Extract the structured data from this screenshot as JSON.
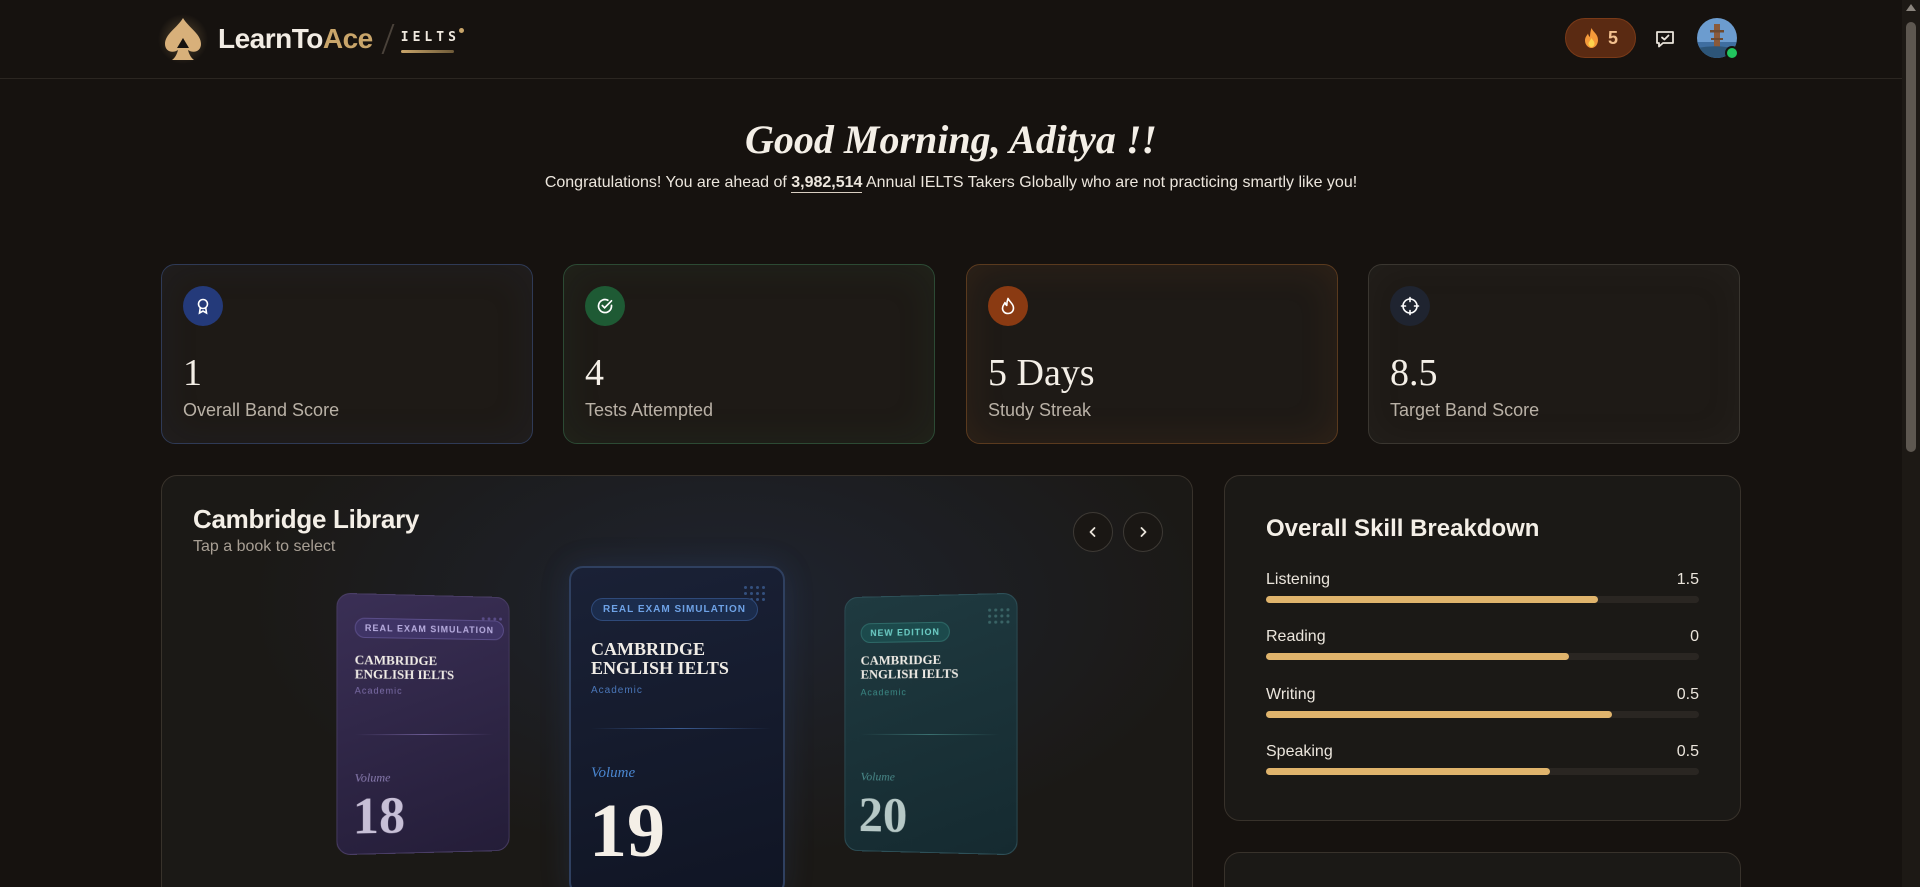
{
  "header": {
    "brand_learn": "LearnTo",
    "brand_ace": "Ace",
    "exam_tag": "IELTS",
    "streak_count": "5",
    "icons": [
      "spade-logo-icon",
      "fire-icon",
      "message-icon",
      "avatar"
    ]
  },
  "greeting": {
    "title": "Good Morning, Aditya !!",
    "congrats_before": "Congratulations! You are ahead of ",
    "congrats_number": "3,982,514",
    "congrats_after": " Annual IELTS Takers Globally who are not practicing smartly like you!"
  },
  "stats": [
    {
      "value": "1",
      "label": "Overall Band Score",
      "icon": "award-icon",
      "color": "#243a7a"
    },
    {
      "value": "4",
      "label": "Tests Attempted",
      "icon": "check-circle-icon",
      "color": "#1e5a34"
    },
    {
      "value": "5 Days",
      "label": "Study Streak",
      "icon": "flame-icon",
      "color": "#8a3a12"
    },
    {
      "value": "8.5",
      "label": "Target Band Score",
      "icon": "crosshair-icon",
      "color": "#1f2430"
    }
  ],
  "library": {
    "title": "Cambridge Library",
    "subtitle": "Tap a book to select",
    "books": [
      {
        "badge": "REAL EXAM SIMULATION",
        "title": "CAMBRIDGE ENGLISH IELTS",
        "type": "Academic",
        "volume_label": "Volume",
        "number": "18"
      },
      {
        "badge": "REAL EXAM SIMULATION",
        "title": "CAMBRIDGE ENGLISH IELTS",
        "type": "Academic",
        "volume_label": "Volume",
        "number": "19"
      },
      {
        "badge": "NEW EDITION",
        "title": "CAMBRIDGE ENGLISH IELTS",
        "type": "Academic",
        "volume_label": "Volume",
        "number": "20"
      }
    ]
  },
  "skills": {
    "title": "Overall Skill Breakdown",
    "items": [
      {
        "name": "Listening",
        "score": "1.5",
        "fill_fraction": 0.766
      },
      {
        "name": "Reading",
        "score": "0",
        "fill_fraction": 0.699
      },
      {
        "name": "Writing",
        "score": "0.5",
        "fill_fraction": 0.799
      },
      {
        "name": "Speaking",
        "score": "0.5",
        "fill_fraction": 0.656
      }
    ],
    "accent_color": "#e0b46c"
  }
}
